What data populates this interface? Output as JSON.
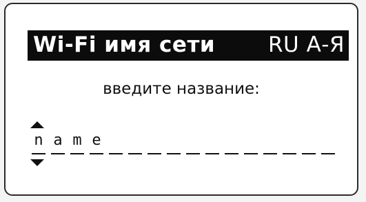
{
  "header": {
    "title": "Wi-Fi имя сети",
    "input_mode": "RU А-Я"
  },
  "prompt": "введите название:",
  "entry": {
    "characters": [
      "n",
      "a",
      "m",
      "e",
      "",
      "",
      "",
      "",
      "",
      "",
      "",
      "",
      "",
      "",
      "",
      ""
    ],
    "cursor_position": 1,
    "cursor_up_icon": "triangle-up-icon",
    "cursor_down_icon": "triangle-down-icon"
  },
  "colors": {
    "screen_bg": "#ffffff",
    "header_bg": "#0c0c0c",
    "header_text": "#ffffff",
    "text": "#111111"
  }
}
